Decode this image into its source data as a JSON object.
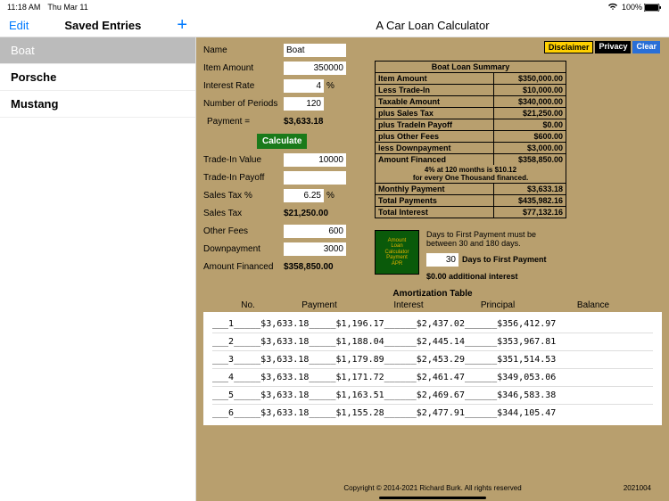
{
  "status": {
    "time": "11:18 AM",
    "date": "Thu Mar 11",
    "battery": "100%"
  },
  "header": {
    "edit": "Edit",
    "saved": "Saved Entries",
    "title": "A Car Loan Calculator"
  },
  "sidebar": {
    "items": [
      "Boat",
      "Porsche",
      "Mustang"
    ],
    "selected": 0
  },
  "buttons": {
    "disclaimer": "Disclaimer",
    "privacy": "Privacy",
    "clear": "Clear",
    "calculate": "Calculate"
  },
  "form": {
    "name_lbl": "Name",
    "name_val": "Boat",
    "item_lbl": "Item Amount",
    "item_val": "350000",
    "rate_lbl": "Interest Rate",
    "rate_val": "4",
    "periods_lbl": "Number of Periods",
    "periods_val": "120",
    "payment_lbl": "Payment =",
    "payment_val": "$3,633.18",
    "tradein_lbl": "Trade-In Value",
    "tradein_val": "10000",
    "payoff_lbl": "Trade-In Payoff",
    "payoff_val": "",
    "taxpct_lbl": "Sales Tax %",
    "taxpct_val": "6.25",
    "tax_lbl": "Sales Tax",
    "tax_val": "$21,250.00",
    "fees_lbl": "Other Fees",
    "fees_val": "600",
    "down_lbl": "Downpayment",
    "down_val": "3000",
    "fin_lbl": "Amount Financed",
    "fin_val": "$358,850.00",
    "pct": "%"
  },
  "summary": {
    "title": "Boat Loan Summary",
    "rows": [
      {
        "l": "Item Amount",
        "r": "$350,000.00"
      },
      {
        "l": "Less Trade-In",
        "r": "$10,000.00"
      },
      {
        "l": "Taxable Amount",
        "r": "$340,000.00"
      },
      {
        "l": "plus Sales Tax",
        "r": "$21,250.00"
      },
      {
        "l": "plus TradeIn Payoff",
        "r": "$0.00"
      },
      {
        "l": "plus Other Fees",
        "r": "$600.00"
      },
      {
        "l": "less Downpayment",
        "r": "$3,000.00"
      },
      {
        "l": "Amount Financed",
        "r": "$358,850.00"
      }
    ],
    "note1": "4% at 120 months is $10.12",
    "note2": "for every One Thousand financed.",
    "rows2": [
      {
        "l": "Monthly Payment",
        "r": "$3,633.18"
      },
      {
        "l": "Total Payments",
        "r": "$435,982.16"
      },
      {
        "l": "Total Interest",
        "r": "$77,132.16"
      }
    ]
  },
  "days": {
    "text1": "Days to First Payment must be",
    "text2": "between 30 and 180 days.",
    "val": "30",
    "label": "Days to First Payment",
    "extra": "$0.00 additional interest"
  },
  "amort": {
    "title": "Amortization Table",
    "headers": [
      "No.",
      "Payment",
      "Interest",
      "Principal",
      "Balance"
    ],
    "rows": [
      {
        "n": "1",
        "p": "$3,633.18",
        "i": "$1,196.17",
        "pr": "$2,437.02",
        "b": "$356,412.97"
      },
      {
        "n": "2",
        "p": "$3,633.18",
        "i": "$1,188.04",
        "pr": "$2,445.14",
        "b": "$353,967.81"
      },
      {
        "n": "3",
        "p": "$3,633.18",
        "i": "$1,179.89",
        "pr": "$2,453.29",
        "b": "$351,514.53"
      },
      {
        "n": "4",
        "p": "$3,633.18",
        "i": "$1,171.72",
        "pr": "$2,461.47",
        "b": "$349,053.06"
      },
      {
        "n": "5",
        "p": "$3,633.18",
        "i": "$1,163.51",
        "pr": "$2,469.67",
        "b": "$346,583.38"
      },
      {
        "n": "6",
        "p": "$3,633.18",
        "i": "$1,155.28",
        "pr": "$2,477.91",
        "b": "$344,105.47"
      }
    ]
  },
  "footer": {
    "copyright": "Copyright © 2014-2021 Richard Burk. All rights reserved",
    "build": "2021004"
  }
}
